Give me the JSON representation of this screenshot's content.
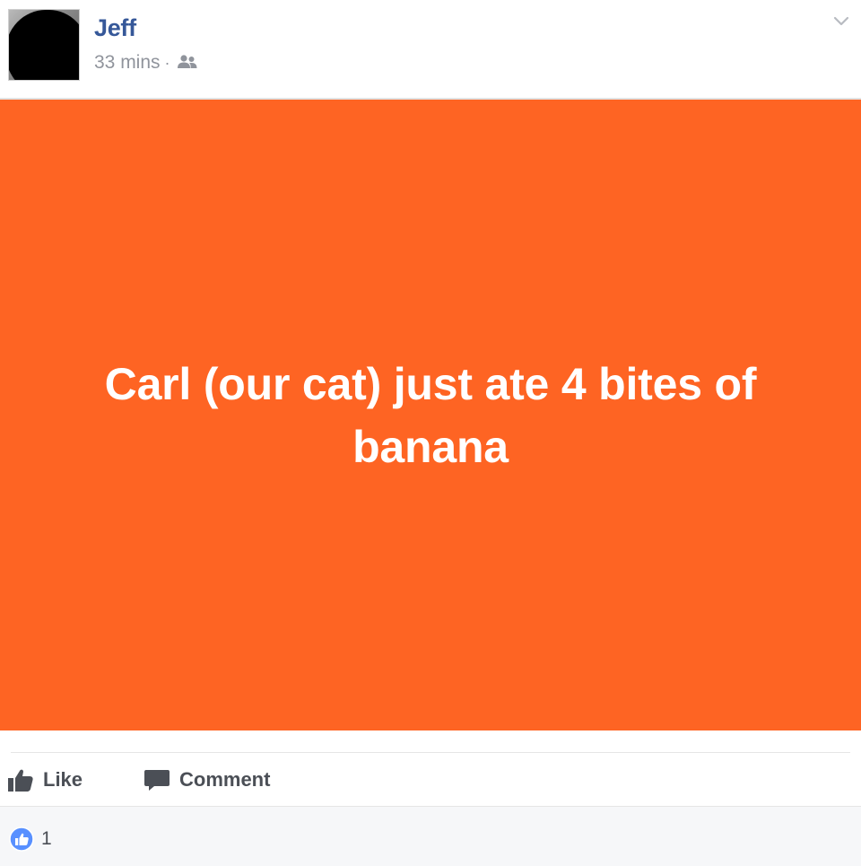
{
  "post": {
    "author": "Jeff",
    "timestamp": "33 mins",
    "separator": "·",
    "audience_icon": "friends-icon",
    "background_color": "#fe6423",
    "text": "Carl (our cat) just ate 4 bites of banana"
  },
  "actions": {
    "like_label": "Like",
    "comment_label": "Comment"
  },
  "reactions": {
    "icon": "like-reaction-icon",
    "count": "1"
  },
  "colors": {
    "name_link": "#365899",
    "meta_text": "#90949c",
    "action_text": "#4b4f56",
    "like_blue": "#5890ff"
  }
}
